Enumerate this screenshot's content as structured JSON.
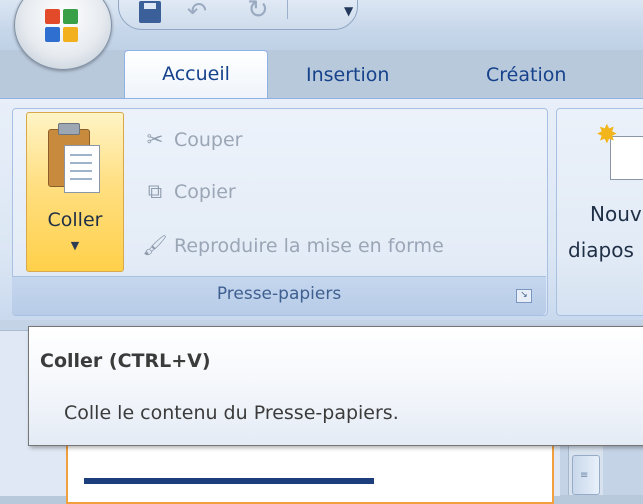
{
  "tabs": [
    "Accueil",
    "Insertion",
    "Création"
  ],
  "clipboard": {
    "paste_label": "Coller",
    "cut_label": "Couper",
    "copy_label": "Copier",
    "format_painter_label": "Reproduire la mise en forme",
    "group_label": "Presse-papiers"
  },
  "new_slide": {
    "line1": "Nouv",
    "line2": "diapos"
  },
  "tooltip": {
    "title": "Coller (CTRL+V)",
    "description": "Colle le contenu du Presse-papiers."
  },
  "icons": {
    "office": "office-logo-icon",
    "save": "save-icon",
    "undo": "undo-icon",
    "redo": "redo-icon",
    "paste": "clipboard-icon",
    "cut": "scissors-icon",
    "copy": "copy-icon",
    "format_painter": "paintbrush-icon",
    "new_slide": "new-slide-icon"
  },
  "colors": {
    "tab_text": "#15428b",
    "ribbon_bg": "#dbe6f4",
    "paste_highlight": "#ffdf82",
    "disabled_text": "#9aa6b6"
  }
}
